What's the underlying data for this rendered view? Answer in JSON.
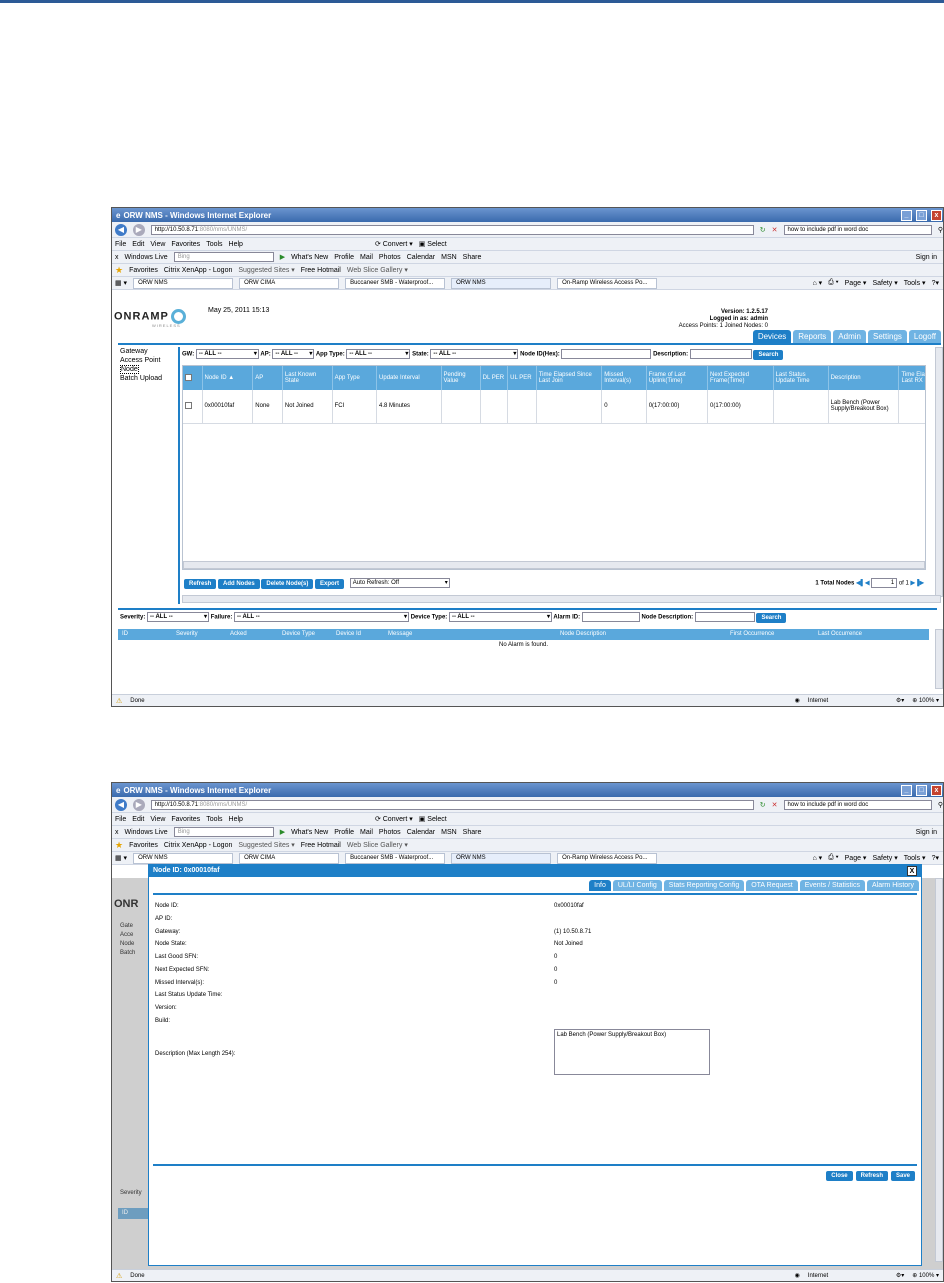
{
  "browser": {
    "title": "ORW NMS - Windows Internet Explorer",
    "url_main": "http://10.50.8.71",
    "url_rest": ":8080/nms/UNMS/",
    "search_text": "how to include pdf in word doc",
    "menu": [
      "File",
      "Edit",
      "View",
      "Favorites",
      "Tools",
      "Help"
    ],
    "convert_label": "Convert",
    "select_label": "Select",
    "windows_live": "Windows Live",
    "bing_placeholder": "Bing",
    "live_links": [
      "What's New",
      "Profile",
      "Mail",
      "Photos",
      "Calendar",
      "MSN",
      "Share"
    ],
    "sign_in": "Sign in",
    "favorites_label": "Favorites",
    "fav_items": [
      "Citrix XenApp - Logon",
      "Suggested Sites ▾",
      "Free Hotmail",
      "Web Slice Gallery ▾"
    ],
    "tabs": [
      "ORW NMS",
      "ORW CIMA",
      "Buccaneer SMB - Waterproof...",
      "ORW NMS",
      "On-Ramp Wireless Access Po..."
    ],
    "cmd_items": [
      "Page ▾",
      "Safety ▾",
      "Tools ▾"
    ],
    "status_done": "Done",
    "status_zone": "Internet",
    "zoom": "100%"
  },
  "app": {
    "logo": "ONRAMP",
    "logo_sub": "WIRELESS",
    "datetime": "May 25, 2011 15:13",
    "version": "Version: 1.2.5.17",
    "logged_in": "Logged in as: admin",
    "counts": "Access Points: 1 Joined Nodes: 0",
    "tabs": [
      "Devices",
      "Reports",
      "Admin",
      "Settings",
      "Logoff"
    ],
    "nav": [
      "Gateway",
      "Access Point",
      "Node",
      "Batch Upload"
    ]
  },
  "filters": {
    "gw_label": "GW:",
    "gw_value": "-- ALL --",
    "ap_label": "AP:",
    "ap_value": "-- ALL --",
    "apptype_label": "App Type:",
    "apptype_value": "-- ALL --",
    "state_label": "State:",
    "state_value": "-- ALL --",
    "nodeid_label": "Node ID(Hex):",
    "desc_label": "Description:",
    "search": "Search"
  },
  "node_table": {
    "columns": [
      "Node ID ▲",
      "AP",
      "Last Known State",
      "App Type",
      "Update Interval",
      "Pending Value",
      "DL PER",
      "UL PER",
      "Time Elapsed Since Last Join",
      "Missed Interval(s)",
      "Frame of Last Uplink(Time)",
      "Next Expected Frame(Time)",
      "Last Status Update Time",
      "Description",
      "Time Elapsed Since Last RX S"
    ],
    "rows": [
      [
        "0x00010faf",
        "None",
        "Not Joined",
        "FCI",
        "4.8 Minutes",
        "",
        "",
        "",
        "",
        "0",
        "0(17:00:00)",
        "0(17:00:00)",
        "",
        "Lab Bench (Power Supply/Breakout Box)",
        ""
      ]
    ]
  },
  "node_actions": {
    "refresh": "Refresh",
    "add": "Add Nodes",
    "delete": "Delete Node(s)",
    "export": "Export",
    "auto_refresh": "Auto Refresh: Off",
    "total": "1 Total Nodes",
    "page": "1",
    "of": "of 1"
  },
  "alarm_filters": {
    "severity_label": "Severity:",
    "severity_value": "-- ALL --",
    "failure_label": "Failure:",
    "failure_value": "-- ALL --",
    "devtype_label": "Device Type:",
    "devtype_value": "-- ALL --",
    "alarmid_label": "Alarm ID:",
    "nodedesc_label": "Node Description:",
    "search": "Search"
  },
  "alarm_table": {
    "columns": [
      "ID",
      "Severity",
      "Acked",
      "Device Type",
      "Device Id",
      "Message",
      "Node Description",
      "First Occurrence",
      "Last Occurrence"
    ],
    "empty": "No Alarm is found."
  },
  "dialog": {
    "title": "Node ID: 0x00010faf",
    "close_x": "X",
    "tabs": [
      "Info",
      "UL/LI Config",
      "Stats Reporting Config",
      "OTA Request",
      "Events / Statistics",
      "Alarm History"
    ],
    "fields": [
      {
        "label": "Node ID:",
        "value": "0x00010faf"
      },
      {
        "label": "AP ID:",
        "value": ""
      },
      {
        "label": "Gateway:",
        "value": "(1) 10.50.8.71"
      },
      {
        "label": "Node State:",
        "value": "Not Joined"
      },
      {
        "label": "Last Good SFN:",
        "value": "0"
      },
      {
        "label": "Next Expected SFN:",
        "value": "0"
      },
      {
        "label": "Missed Interval(s):",
        "value": "0"
      },
      {
        "label": "Last Status Update Time:",
        "value": ""
      },
      {
        "label": "Version:",
        "value": ""
      },
      {
        "label": "Build:",
        "value": ""
      }
    ],
    "desc_label": "Description (Max Length 254):",
    "desc_value": "Lab Bench (Power Supply/Breakout Box)",
    "buttons": [
      "Close",
      "Refresh",
      "Save"
    ]
  },
  "bg_fragments": {
    "logo": "ONR",
    "nav": [
      "Gate",
      "Acce",
      "Node",
      "Batch"
    ],
    "severity": "Severity",
    "id": "ID"
  }
}
